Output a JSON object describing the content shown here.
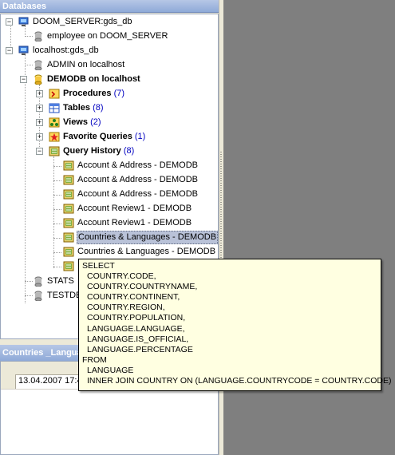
{
  "panel_title": "Databases",
  "tree": {
    "doom_server": {
      "label": "DOOM_SERVER:gds_db"
    },
    "employee": {
      "label": "employee on DOOM_SERVER"
    },
    "localhost": {
      "label": "localhost:gds_db"
    },
    "admin": {
      "label": "ADMIN on localhost"
    },
    "demodb": {
      "label": "DEMODB on localhost"
    },
    "procedures": {
      "label": "Procedures",
      "count": "(7)"
    },
    "tables": {
      "label": "Tables",
      "count": "(8)"
    },
    "views": {
      "label": "Views",
      "count": "(2)"
    },
    "favorites": {
      "label": "Favorite Queries",
      "count": "(1)"
    },
    "history": {
      "label": "Query History",
      "count": "(8)"
    },
    "history_items": [
      {
        "label": "Account & Address - DEMODB"
      },
      {
        "label": "Account & Address - DEMODB"
      },
      {
        "label": "Account & Address - DEMODB"
      },
      {
        "label": "Account Review1 - DEMODB"
      },
      {
        "label": "Account Review1 - DEMODB"
      },
      {
        "label": "Countries & Languages - DEMODB"
      },
      {
        "label": "Countries & Languages - DEMODB"
      },
      {
        "label": ""
      }
    ],
    "stats": {
      "label": "STATS"
    },
    "testdb": {
      "label": "TESTDE"
    }
  },
  "bottom_panel": {
    "title": "Countries _Langua",
    "row_value": "13.04.2007 17:4"
  },
  "tooltip": {
    "lines": [
      "SELECT",
      "  COUNTRY.CODE,",
      "  COUNTRY.COUNTRYNAME,",
      "  COUNTRY.CONTINENT,",
      "  COUNTRY.REGION,",
      "  COUNTRY.POPULATION,",
      "  LANGUAGE.LANGUAGE,",
      "  LANGUAGE.IS_OFFICIAL,",
      "  LANGUAGE.PERCENTAGE",
      "FROM",
      "  LANGUAGE",
      "  INNER JOIN COUNTRY ON (LANGUAGE.COUNTRYCODE = COUNTRY.CODE)"
    ]
  },
  "icons": {
    "server": "server-icon",
    "database": "database-icon",
    "procedures": "procedures-icon",
    "tables": "tables-icon",
    "views": "views-icon",
    "favorites": "star-icon",
    "history": "query-history-icon",
    "query": "query-icon"
  }
}
